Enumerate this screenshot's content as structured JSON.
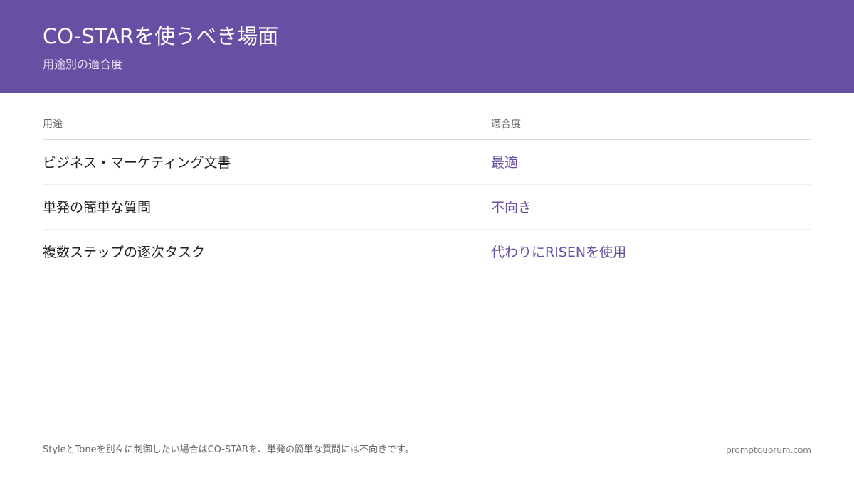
{
  "header": {
    "title": "CO-STARを使うべき場面",
    "subtitle": "用途別の適合度"
  },
  "table": {
    "columns": [
      "用途",
      "適合度"
    ],
    "rows": [
      {
        "use_case": "ビジネス・マーケティング文書",
        "fit": "最適"
      },
      {
        "use_case": "単発の簡単な質問",
        "fit": "不向き"
      },
      {
        "use_case": "複数ステップの逐次タスク",
        "fit": "代わりにRISENを使用"
      }
    ]
  },
  "footer": {
    "note": "StyleとToneを別々に制御したい場合はCO-STARを、単発の簡単な質問には不向きです。",
    "site": "promptquorum.com"
  },
  "colors": {
    "header_bg": "#674fa3",
    "accent": "#674fa3"
  }
}
